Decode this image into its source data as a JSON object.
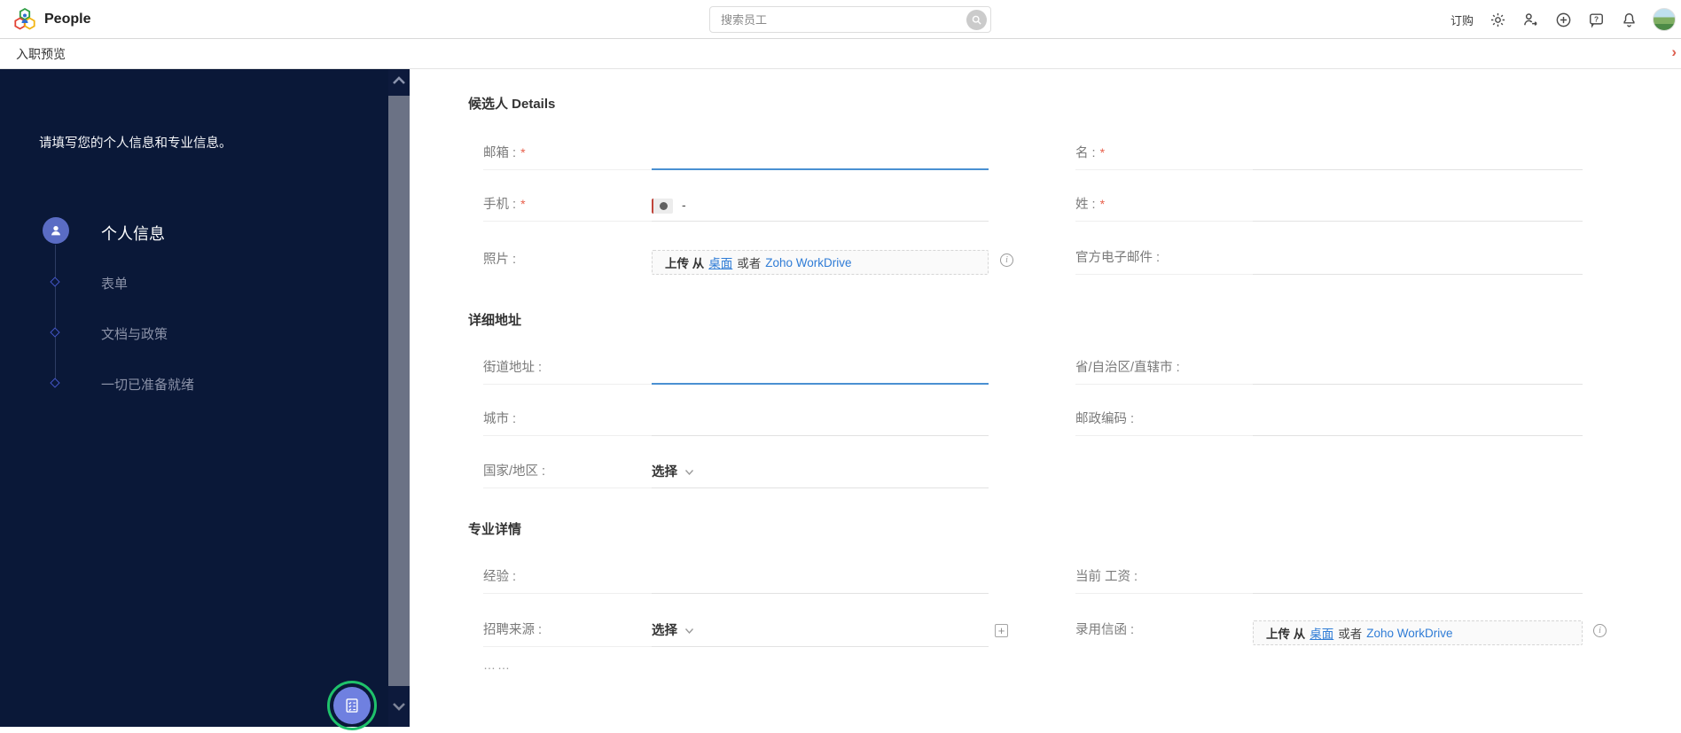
{
  "colors": {
    "accent_blue": "#4a90d2",
    "sidebar_bg": "#0a1838",
    "step_badge": "#5a6cc4",
    "fab_ring": "#1fc26b",
    "fab_fill": "#6f80e0",
    "link_blue": "#2f7cd6",
    "required_red": "#e8604c"
  },
  "header": {
    "app_name": "People",
    "search_placeholder": "搜索员工",
    "subscribe_label": "订购",
    "icons": [
      "search-icon",
      "gear-icon",
      "user-switch-icon",
      "plus-circle-icon",
      "help-icon",
      "bell-icon",
      "avatar"
    ]
  },
  "subheader": {
    "title": "入职预览",
    "chevron": "›"
  },
  "sidebar": {
    "intro": "请填写您的个人信息和专业信息。",
    "steps": [
      {
        "label": "个人信息",
        "state": "active",
        "icon": "person-icon"
      },
      {
        "label": "表单",
        "state": "upcoming"
      },
      {
        "label": "文档与政策",
        "state": "upcoming"
      },
      {
        "label": "一切已准备就绪",
        "state": "upcoming"
      }
    ],
    "fab_icon": "checklist-icon"
  },
  "form": {
    "sections": {
      "candidate": {
        "title": "候选人 Details"
      },
      "address": {
        "title": "详细地址"
      },
      "professional": {
        "title": "专业详情"
      }
    },
    "fields": {
      "email": {
        "label": "邮箱 :",
        "required": "*"
      },
      "mobile": {
        "label": "手机 :",
        "required": "*",
        "value": "-"
      },
      "photo": {
        "label": "照片 :"
      },
      "first_name": {
        "label": "名 :",
        "required": "*"
      },
      "last_name": {
        "label": "姓 :",
        "required": "*"
      },
      "official_email": {
        "label": "官方电子邮件 :"
      },
      "street": {
        "label": "街道地址 :"
      },
      "city": {
        "label": "城市 :"
      },
      "country": {
        "label": "国家/地区 :",
        "value": "选择"
      },
      "state": {
        "label": "省/自治区/直辖市 :"
      },
      "zip": {
        "label": "邮政编码 :"
      },
      "experience": {
        "label": "经验 :"
      },
      "source": {
        "label": "招聘来源 :",
        "value": "选择"
      },
      "current_salary": {
        "label": "当前 工资 :"
      },
      "offer_letter": {
        "label": "录用信函 :"
      }
    },
    "upload": {
      "prefix": "上传 从",
      "desktop_link": "桌面",
      "or_text": "或者",
      "workdrive_link": "Zoho WorkDrive"
    },
    "more_indicator": "……"
  }
}
